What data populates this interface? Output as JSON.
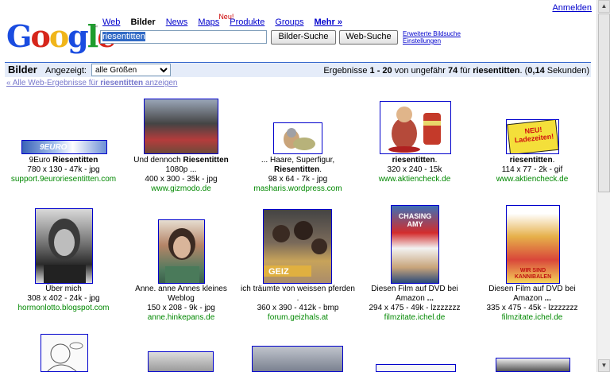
{
  "header": {
    "signin": "Anmelden",
    "logo": "Google",
    "nav": [
      "Web",
      "Bilder",
      "News",
      "Maps",
      "Produkte",
      "Groups",
      "Mehr »"
    ],
    "nav_badge": "Neu!",
    "search_value": "riesentitten",
    "image_search_button": "Bilder-Suche",
    "web_search_button": "Web-Suche",
    "advanced_link": "Erweiterte Bildsuche",
    "settings_link": "Einstellungen"
  },
  "results_bar": {
    "title": "Bilder",
    "shown_label": "Angezeigt:",
    "size_select": "alle Größen",
    "stats_prefix": "Ergebnisse",
    "stats_range": "1 - 20",
    "stats_mid": "von ungefähr",
    "stats_count": "74",
    "stats_for": "für",
    "stats_query": "riesentitten",
    "stats_time_open": ". (",
    "stats_time": "0,14",
    "stats_time_close": "Sekunden)",
    "all_web_prefix": "« Alle Web-Ergebnisse für",
    "all_web_query": "riesentitten",
    "all_web_suffix": "anzeigen"
  },
  "results": [
    {
      "title_pre": "9Euro ",
      "title_bold": "Riesentitten",
      "title_post": "",
      "meta": "780 x 130 - 47k - jpg",
      "url": "support.9euroriesentitten.com"
    },
    {
      "title_pre": "Und dennoch ",
      "title_bold": "Riesentitten",
      "title_post": " 1080p ...",
      "meta": "400 x 300 - 35k - jpg",
      "url": "www.gizmodo.de"
    },
    {
      "title_pre": "... Haare, Superfigur, ",
      "title_bold": "Riesentitten",
      "title_post": ".",
      "meta": "98 x 64 - 7k - jpg",
      "url": "masharis.wordpress.com"
    },
    {
      "title_pre": "",
      "title_bold": "riesentitten",
      "title_post": ".",
      "meta": "320 x 240 - 15k",
      "url": "www.aktiencheck.de"
    },
    {
      "title_pre": "",
      "title_bold": "riesentitten",
      "title_post": ".",
      "meta": "114 x 77 - 2k - gif",
      "url": "www.aktiencheck.de"
    },
    {
      "title_pre": "Über mich",
      "title_bold": "",
      "title_post": "",
      "meta": "308 x 402 - 24k - jpg",
      "url": "hormonlotto.blogspot.com"
    },
    {
      "title_pre": "Anne. anne Annes kleines Weblog",
      "title_bold": "",
      "title_post": "",
      "meta": "150 x 208 - 9k - jpg",
      "url": "anne.hinkepans.de"
    },
    {
      "title_pre": "ich träumte von weissen pferden .",
      "title_bold": "",
      "title_post": "",
      "meta": "360 x 390 - 412k - bmp",
      "url": "forum.geizhals.at"
    },
    {
      "title_pre": "Diesen Film auf DVD bei Amazon ",
      "title_bold": "...",
      "title_post": "",
      "meta": "294 x 475 - 49k - lzzzzzzz",
      "url": "filmzitate.ichel.de"
    },
    {
      "title_pre": "Diesen Film auf DVD bei Amazon ",
      "title_bold": "...",
      "title_post": "",
      "meta": "335 x 475 - 45k - lzzzzzzz",
      "url": "filmzitate.ichel.de"
    }
  ],
  "thumb_texts": {
    "t1": "9EURO",
    "t5": "NEU! Ladezeiten!",
    "t9": "CHASING AMY",
    "t10": "WIR SIND KANNIBALEN"
  }
}
